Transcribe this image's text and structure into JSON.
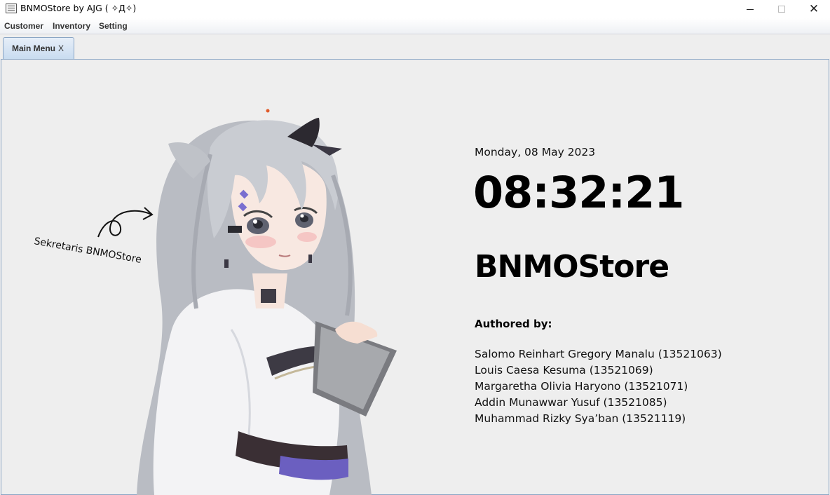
{
  "window": {
    "title": "BNMOStore by AJG ( ✧Д✧)",
    "icon": "app-icon",
    "controls": {
      "minimize_icon": "minimize-icon",
      "maximize_icon": "maximize-icon",
      "close_icon": "close-icon",
      "close_glyph": "✕"
    }
  },
  "menu": {
    "items": [
      {
        "label": "Customer"
      },
      {
        "label": "Inventory"
      },
      {
        "label": "Setting"
      }
    ]
  },
  "tabs": [
    {
      "label": "Main Menu",
      "close_label": "X",
      "selected": true
    }
  ],
  "main": {
    "illustration_caption": "Sekretaris BNMOStore",
    "date": "Monday, 08 May 2023",
    "time": "08:32:21",
    "store_name": "BNMOStore",
    "authored_label": "Authored by:",
    "authors": [
      "Salomo Reinhart Gregory Manalu (13521063)",
      "Louis Caesa Kesuma (13521069)",
      "Margaretha Olivia Haryono (13521071)",
      "Addin Munawwar Yusuf (13521085)",
      "Muhammad Rizky Sya’ban (13521119)"
    ]
  },
  "colors": {
    "background": "#eeeeee",
    "tab_selected": "#c9dcf0",
    "tab_border": "#8aa5c4",
    "text": "#000000"
  }
}
